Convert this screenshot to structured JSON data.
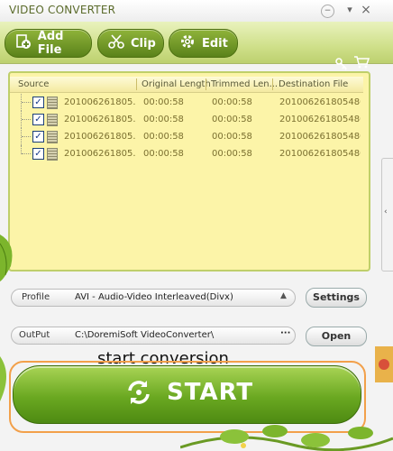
{
  "window": {
    "title": "VIDEO CONVERTER",
    "min_glyph": "−",
    "dropdown_glyph": "▾",
    "close_glyph": "×"
  },
  "toolbar": {
    "add_file": "Add File",
    "clip": "Clip",
    "edit": "Edit"
  },
  "file_table": {
    "columns": [
      "Source",
      "Original Length",
      "Trimmed Len...",
      "Destination File"
    ],
    "rows": [
      {
        "source": "201006261805...",
        "original": "00:00:58",
        "trimmed": "00:00:58",
        "dest": "201006261805480..."
      },
      {
        "source": "201006261805...",
        "original": "00:00:58",
        "trimmed": "00:00:58",
        "dest": "201006261805480..."
      },
      {
        "source": "201006261805...",
        "original": "00:00:58",
        "trimmed": "00:00:58",
        "dest": "201006261805480..."
      },
      {
        "source": "201006261805...",
        "original": "00:00:58",
        "trimmed": "00:00:58",
        "dest": "201006261805480..."
      }
    ],
    "checkmark": "✓"
  },
  "profile": {
    "label": "Profile",
    "value": "AVI - Audio-Video Interleaved(Divx)",
    "settings_label": "Settings"
  },
  "output": {
    "label": "OutPut",
    "path": "C:\\DoremiSoft  VideoConverter\\",
    "browse_glyph": "···",
    "open_label": "Open"
  },
  "start": {
    "hint": "start conversion",
    "label": "START"
  },
  "side_tab_glyph": "‹",
  "colors": {
    "accent_green": "#6aa821",
    "list_bg": "#fcf4a8",
    "highlight_outline": "#f2a04a"
  }
}
